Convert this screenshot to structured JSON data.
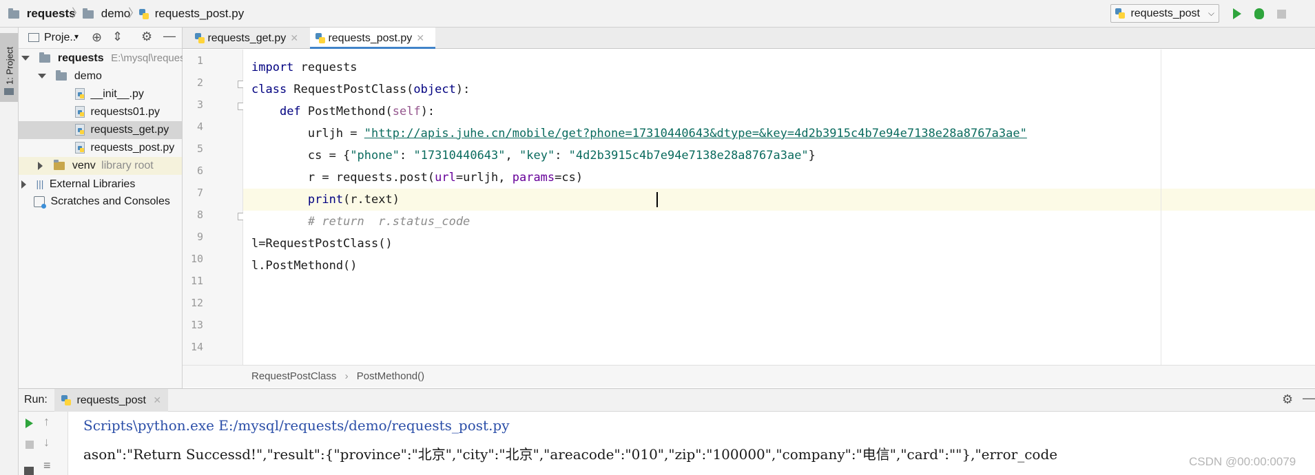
{
  "navbar": {
    "crumb_project": "requests",
    "crumb_folder": "demo",
    "crumb_file": "requests_post.py",
    "run_config": "requests_post"
  },
  "sidebar": {
    "tool_tab": "1: Project",
    "header": "Proje..",
    "tree": {
      "root_name": "requests",
      "root_path": "E:\\mysql\\reques",
      "demo": "demo",
      "files": [
        "__init__.py",
        "requests01.py",
        "requests_get.py",
        "requests_post.py"
      ],
      "venv": "venv",
      "venv_note": "library root",
      "external": "External Libraries",
      "scratches": "Scratches and Consoles"
    }
  },
  "tabs": [
    {
      "label": "requests_get.py",
      "active": false
    },
    {
      "label": "requests_post.py",
      "active": true
    }
  ],
  "editor": {
    "line_numbers": [
      "1",
      "2",
      "3",
      "4",
      "5",
      "6",
      "7",
      "8",
      "9",
      "10",
      "11",
      "12",
      "13",
      "14"
    ],
    "l1": {
      "kw": "import",
      "rest": " requests"
    },
    "l2": {
      "kw": "class",
      "name": " RequestPostClass(",
      "base": "object",
      "end": "):"
    },
    "l3": {
      "indent": "    ",
      "kw": "def",
      "name": " PostMethond(",
      "self": "self",
      "end": "):"
    },
    "l4": {
      "indent": "        ",
      "var": "urljh = ",
      "url": "\"http://apis.juhe.cn/mobile/get?phone=17310440643&dtype=&key=4d2b3915c4b7e94e7138e28a8767a3ae\""
    },
    "l5": {
      "indent": "        ",
      "pre": "cs = {",
      "k1": "\"phone\"",
      "c1": ": ",
      "v1": "\"17310440643\"",
      "c2": ", ",
      "k2": "\"key\"",
      "c3": ": ",
      "v2": "\"4d2b3915c4b7e94e7138e28a8767a3ae\"",
      "end": "}"
    },
    "l6": {
      "indent": "        ",
      "pre": "r = requests.post(",
      "p1": "url",
      "mid": "=urljh, ",
      "p2": "params",
      "end": "=cs)"
    },
    "l7": {
      "indent": "        ",
      "fn": "print",
      "rest": "(r.text)"
    },
    "l8": {
      "indent": "        ",
      "comment": "# return  r.status_code"
    },
    "l9": "l=RequestPostClass()",
    "l10": "l.PostMethond()"
  },
  "breadcrumb": {
    "class": "RequestPostClass",
    "method": "PostMethond()"
  },
  "run": {
    "label": "Run:",
    "tab": "requests_post",
    "lines": [
      "Scripts\\python.exe E:/mysql/requests/demo/requests_post.py",
      "ason\":\"Return Successd!\",\"result\":{\"province\":\"北京\",\"city\":\"北京\",\"areacode\":\"010\",\"zip\":\"100000\",\"company\":\"电信\",\"card\":\"\"},\"error_code"
    ]
  },
  "watermark": "CSDN @00:00:0079",
  "colors": {
    "accent": "#4083c9",
    "run_green": "#2ea43c",
    "keyword": "#000080",
    "string": "#067d17"
  }
}
